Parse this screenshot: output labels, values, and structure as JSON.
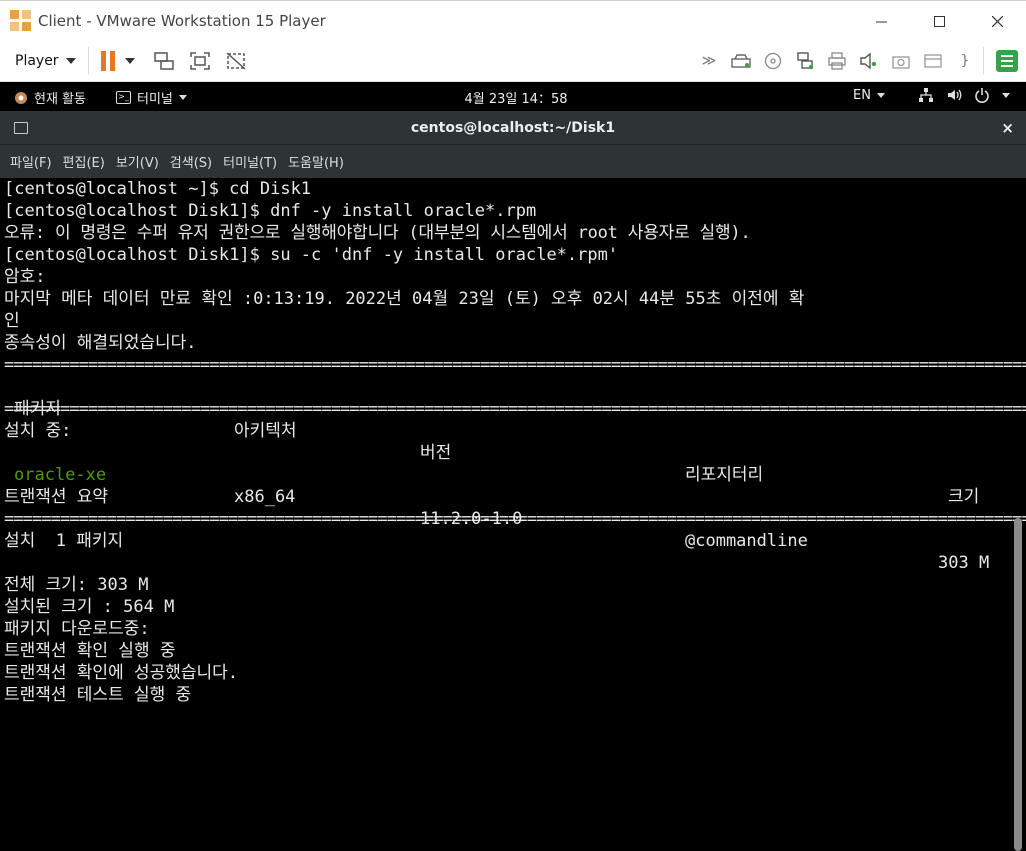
{
  "vmware": {
    "title": "Client - VMware Workstation 15 Player",
    "player_label": "Player",
    "icons": [
      "pause-icon",
      "dropdown-icon",
      "send-ctrl-alt-del-icon",
      "fullscreen-icon",
      "unity-icon"
    ],
    "right_icons": [
      "forward-icon",
      "hard-disk-icon",
      "cd-icon",
      "network-icon",
      "printer-icon",
      "sound-icon",
      "camera-icon",
      "removable-icon",
      "brace-icon",
      "message-log-icon"
    ],
    "accent_orange": "#e57820",
    "accent_green": "#3aa14a"
  },
  "gnome": {
    "activities": "현재 활동",
    "terminal_menu": "터미널",
    "clock": "4월 23일  14：58",
    "lang": "EN"
  },
  "terminal": {
    "title": "centos@localhost:~/Disk1",
    "close": "×",
    "menu": [
      "파일(F)",
      "편집(E)",
      "보기(V)",
      "검색(S)",
      "터미널(T)",
      "도움말(H)"
    ],
    "lines": [
      "[centos@localhost ~]$ cd Disk1",
      "[centos@localhost Disk1]$ dnf -y install oracle*.rpm",
      "오류: 이 명령은 수퍼 유저 권한으로 실행해야합니다 (대부분의 시스템에서 root 사용자로 실행).",
      "[centos@localhost Disk1]$ su -c 'dnf -y install oracle*.rpm'",
      "암호:",
      "마지막 메타 데이터 만료 확인 :0:13:19. 2022년 04월 23일 (토) 오후 02시 44분 55초 이전에 확",
      "인",
      "종속성이 해결되었습니다."
    ],
    "separator": "=====================================================================================================================",
    "table_header": {
      "package": "패키지",
      "arch": "아키텍처",
      "version": "버전",
      "repo": "리포지터리",
      "size": "크기"
    },
    "installing_label": "설치 중:",
    "package_row": {
      "name": "oracle-xe",
      "arch": "x86_64",
      "version": "11.2.0-1.0",
      "repo": "@commandline",
      "size": "303 M"
    },
    "summary_title": "트랜잭션 요약",
    "summary_install": "설치  1 패키지",
    "tail_lines": [
      "전체 크기: 303 M",
      "설치된 크기 : 564 M",
      "패키지 다운로드중:",
      "트랜잭션 확인 실행 중",
      "트랜잭션 확인에 성공했습니다.",
      "트랜잭션 테스트 실행 중"
    ],
    "package_color": "#4e9a06",
    "bg_color": "#000000"
  }
}
